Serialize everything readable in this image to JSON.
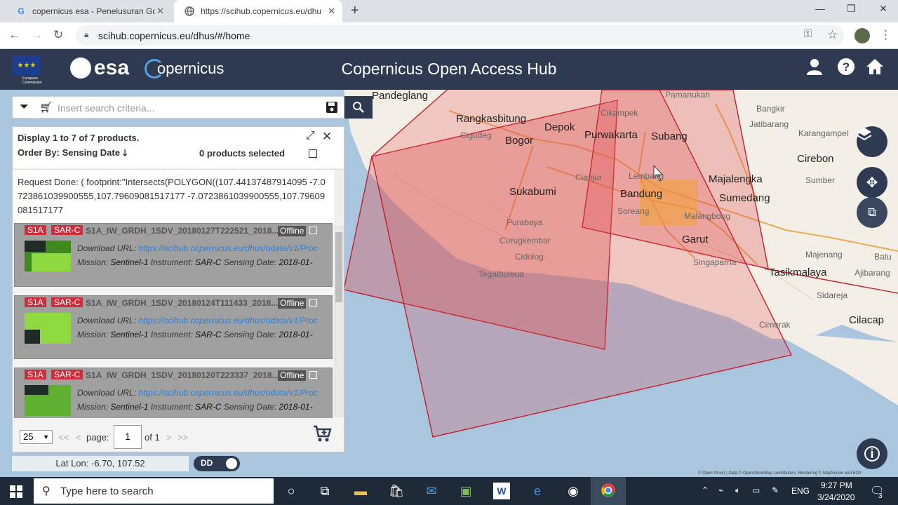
{
  "browser": {
    "tabs": [
      {
        "title": "copernicus esa - Penelusuran Goo",
        "favicon": "G"
      },
      {
        "title": "https://scihub.copernicus.eu/dhu",
        "favicon": "globe-icon"
      }
    ],
    "url": "scihub.copernicus.eu/dhus/#/home"
  },
  "header": {
    "title": "Copernicus Open Access Hub",
    "esa_logo": "esa",
    "copernicus_logo": "opernicus",
    "eu_caption": "European Commission"
  },
  "search": {
    "placeholder": "Insert search criteria..."
  },
  "results": {
    "display_text": "Display 1 to 7 of 7 products.",
    "order_by": "Order By: Sensing Date",
    "selected_text": "0 products selected",
    "request_text": "Request Done: ( footprint:\"Intersects(POLYGON((107.44137487914095 -7.0723861039900555,107.79609081517177 -7.0723861039900555,107.79609081517177",
    "products": [
      {
        "tag1": "S1A",
        "tag2": "SAR-C",
        "name": "S1A_IW_GRDH_1SDV_20180127T222521_2018...",
        "status": "Offline",
        "dl_label": "Download URL:",
        "dl_url": "https://scihub.copernicus.eu/dhus/odata/v1/Proc",
        "mission_label": "Mission:",
        "mission": "Sentinel-1",
        "instrument_label": "Instrument:",
        "instrument": "SAR-C",
        "sensing_label": "Sensing Date:",
        "sensing": "2018-01-"
      },
      {
        "tag1": "S1A",
        "tag2": "SAR-C",
        "name": "S1A_IW_GRDH_1SDV_20180124T111433_2018...",
        "status": "Offline",
        "dl_label": "Download URL:",
        "dl_url": "https://scihub.copernicus.eu/dhus/odata/v1/Proc",
        "mission_label": "Mission:",
        "mission": "Sentinel-1",
        "instrument_label": "Instrument:",
        "instrument": "SAR-C",
        "sensing_label": "Sensing Date:",
        "sensing": "2018-01-"
      },
      {
        "tag1": "S1A",
        "tag2": "SAR-C",
        "name": "S1A_IW_GRDH_1SDV_20180120T223337_2018...",
        "status": "Offline",
        "dl_label": "Download URL:",
        "dl_url": "https://scihub.copernicus.eu/dhus/odata/v1/Proc",
        "mission_label": "Mission:",
        "mission": "Sentinel-1",
        "instrument_label": "Instrument:",
        "instrument": "SAR-C",
        "sensing_label": "Sensing Date:",
        "sensing": "2018-01-"
      }
    ],
    "pager": {
      "per_page": "25",
      "first": "<<",
      "prev": "<",
      "page_label": "page:",
      "page": "1",
      "of_label": "of 1",
      "next": ">",
      "last": ">>"
    }
  },
  "map": {
    "towns": [
      "Pandeglang",
      "Rangkasbitung",
      "Depok",
      "Purwakarta",
      "Subang",
      "Pamanukan",
      "Bangkir",
      "Jatibarang",
      "Karangampel",
      "Cirebon",
      "Bogor",
      "Cikampek",
      "Cigudeg",
      "Cianjur",
      "Lembang",
      "Majalengka",
      "Sumber",
      "Sukabumi",
      "Bandung",
      "Soreang",
      "Sumedang",
      "Malangbong",
      "Purabaya",
      "Curugkembar",
      "Garut",
      "Cidolog",
      "Singaparna",
      "Majenang",
      "Batu",
      "Tegalbuleud",
      "Tasikmalaya",
      "Ajibarang",
      "Sidareja",
      "Cimerak",
      "Cilacap"
    ],
    "attribution": "© Open Street | Data © OpenStreetMap contributors. Rendering © MapServer and EOX"
  },
  "footer": {
    "latlon": "Lat Lon: -6.70, 107.52",
    "dd_label": "DD"
  },
  "taskbar": {
    "search_placeholder": "Type here to search",
    "lang": "ENG",
    "time": "9:27 PM",
    "date": "3/24/2020",
    "notifications": "3"
  },
  "colors": {
    "header_bg": "#2d3a52",
    "accent_red": "#d02c3c",
    "footprint_fill": "#e06a6a",
    "aoi_fill": "#f0a030",
    "link": "#2d7fd9"
  }
}
